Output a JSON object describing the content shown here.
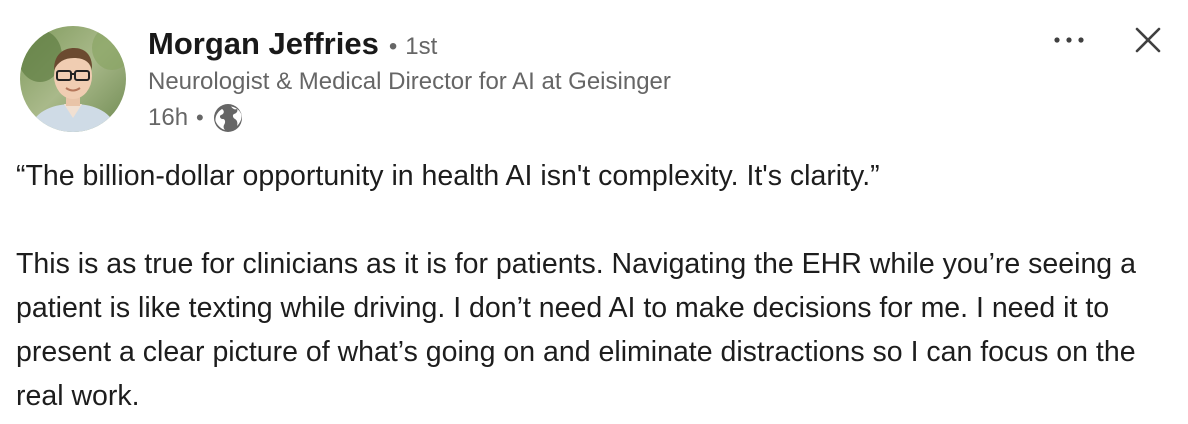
{
  "author": {
    "name": "Morgan Jeffries",
    "connection_separator": "•",
    "connection_degree": "1st",
    "headline": "Neurologist & Medical Director for AI at Geisinger",
    "posted_time": "16h",
    "time_separator": "•",
    "visibility_icon": "globe-icon",
    "avatar_icon": "profile-photo"
  },
  "controls": {
    "more_icon": "more-horizontal-icon",
    "close_icon": "close-icon"
  },
  "post": {
    "quote": "“The billion-dollar opportunity in health AI isn't complexity. It's clarity.”",
    "paragraph": "This is as true for clinicians as it is for patients. Navigating the EHR while you’re seeing a patient is like texting while driving. I don’t need AI to make decisions for me. I need it to present a clear picture of what’s going on and eliminate distractions so I can focus on the real work."
  },
  "colors": {
    "name": "#191919",
    "secondary_text": "#666666",
    "body_text": "#1d1d1d",
    "background": "#ffffff"
  }
}
